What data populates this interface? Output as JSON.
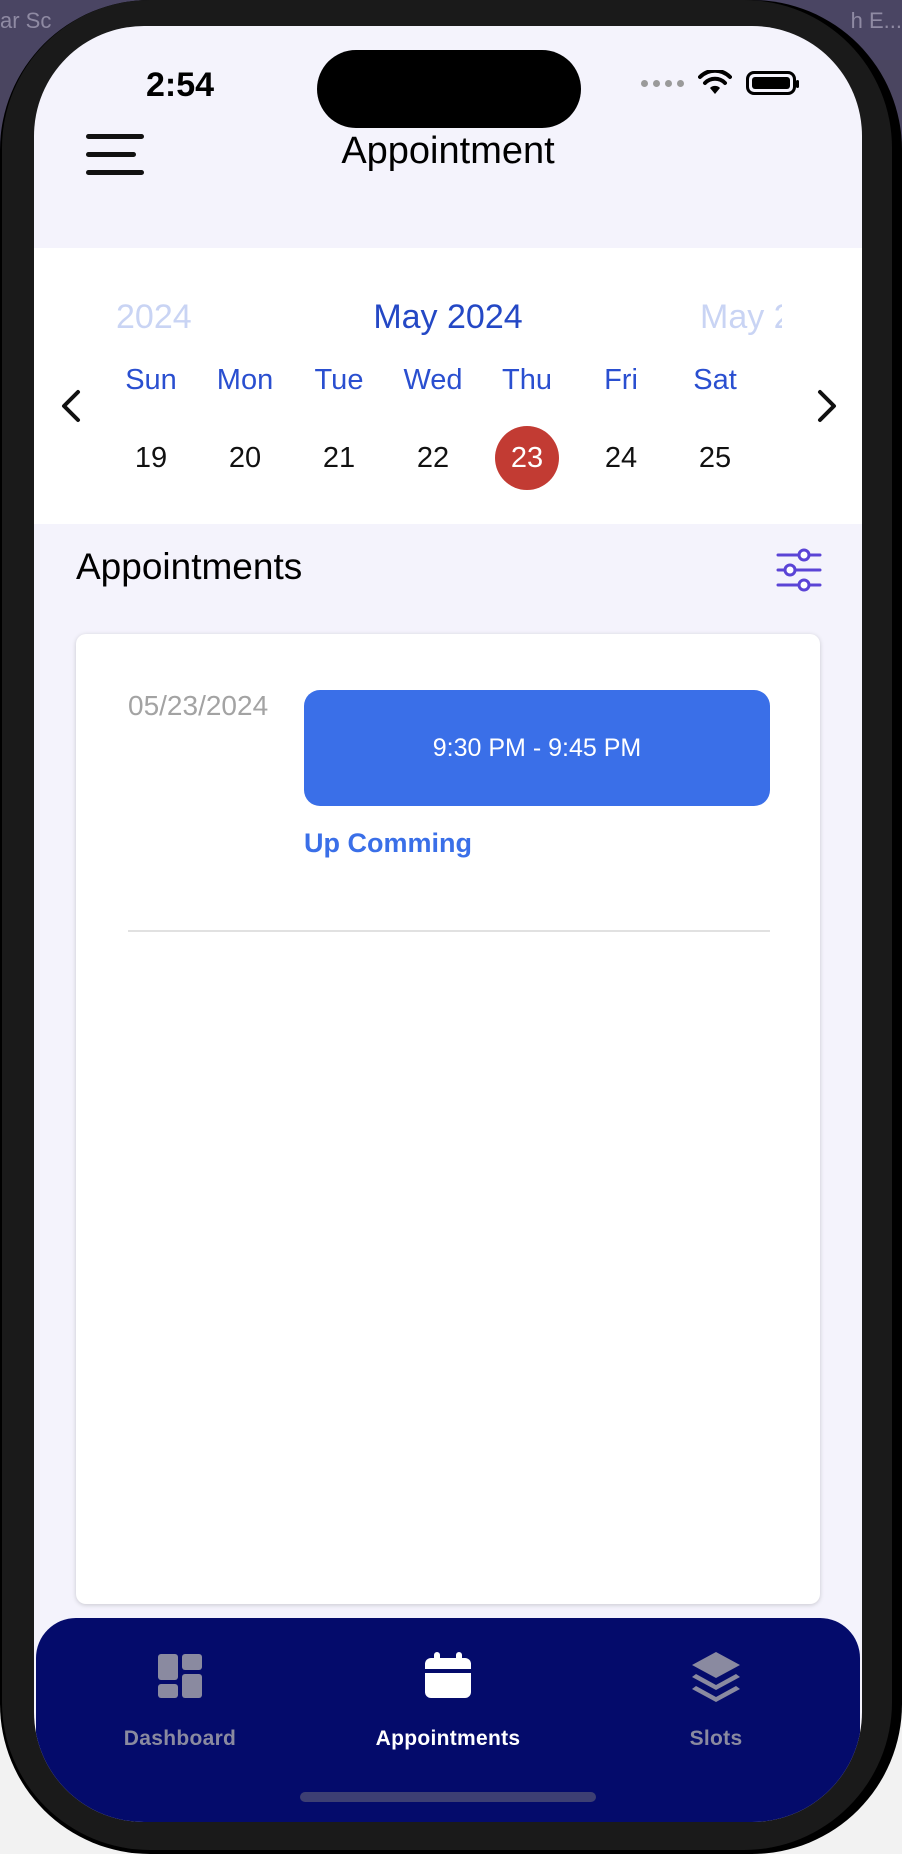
{
  "background": {
    "left_text": "ar Sc",
    "right_text": "h E..."
  },
  "status_bar": {
    "time": "2:54"
  },
  "header": {
    "title": "Appointment"
  },
  "calendar": {
    "month_prev": "2024",
    "month_current": "May 2024",
    "month_next": "May 2",
    "days": [
      {
        "name": "Sun",
        "num": "19"
      },
      {
        "name": "Mon",
        "num": "20"
      },
      {
        "name": "Tue",
        "num": "21"
      },
      {
        "name": "Wed",
        "num": "22"
      },
      {
        "name": "Thu",
        "num": "23",
        "selected": true
      },
      {
        "name": "Fri",
        "num": "24"
      },
      {
        "name": "Sat",
        "num": "25"
      }
    ]
  },
  "appointments": {
    "title": "Appointments",
    "items": [
      {
        "date": "05/23/2024",
        "time_range": "9:30 PM - 9:45 PM",
        "status": "Up Comming"
      }
    ]
  },
  "tabbar": {
    "tabs": [
      {
        "label": "Dashboard",
        "icon": "dashboard-icon",
        "active": false
      },
      {
        "label": "Appointments",
        "icon": "calendar-icon",
        "active": true
      },
      {
        "label": "Slots",
        "icon": "layers-icon",
        "active": false
      }
    ]
  },
  "colors": {
    "accent_blue": "#2a4fd0",
    "slot_blue": "#3a6fe8",
    "selected_day": "#c23b33",
    "tabbar_bg": "#040b6b"
  }
}
